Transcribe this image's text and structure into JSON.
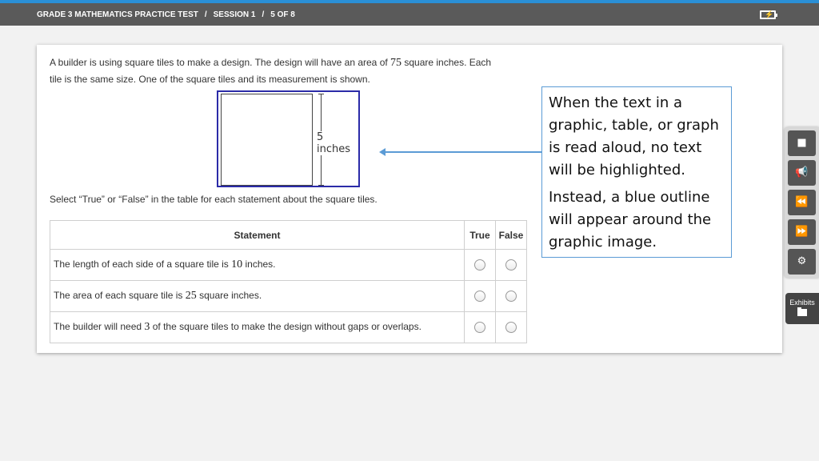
{
  "header": {
    "test_title": "GRADE 3 MATHEMATICS PRACTICE TEST",
    "separator": "/",
    "session": "SESSION 1",
    "progress": "5 OF 8"
  },
  "question": {
    "line1_pre": "A builder is using square tiles to make a design. The design will have an area of ",
    "line1_num": "75",
    "line1_post": " square inches. Each",
    "line2": "tile is the same size. One of the square tiles and its measurement is shown.",
    "figure_label": "5 inches",
    "instruction": "Select “True” or “False” in the table for each statement about the square tiles."
  },
  "table": {
    "headers": [
      "Statement",
      "True",
      "False"
    ],
    "rows": [
      {
        "pre": "The length of each side of a square tile is ",
        "num": "10",
        "post": " inches."
      },
      {
        "pre": "The area of each square tile is ",
        "num": "25",
        "post": " square inches."
      },
      {
        "pre": "The builder will need ",
        "num": "3",
        "post": " of the square tiles to make the design without gaps or overlaps."
      }
    ]
  },
  "callout": {
    "para1": "When the text in a graphic, table, or graph is read aloud, no text will be highlighted.",
    "para2": "Instead, a blue outline will appear around the graphic image."
  },
  "toolbar": {
    "stop_icon": "■",
    "speak_icon": "📢",
    "rewind_icon": "⏪",
    "forward_icon": "⏩",
    "settings_icon": "⚙"
  },
  "exhibits": {
    "label": "Exhibits"
  },
  "colors": {
    "accent": "#2a8fd6",
    "outline": "#2b2ba8",
    "callout_border": "#5b9bd5"
  }
}
